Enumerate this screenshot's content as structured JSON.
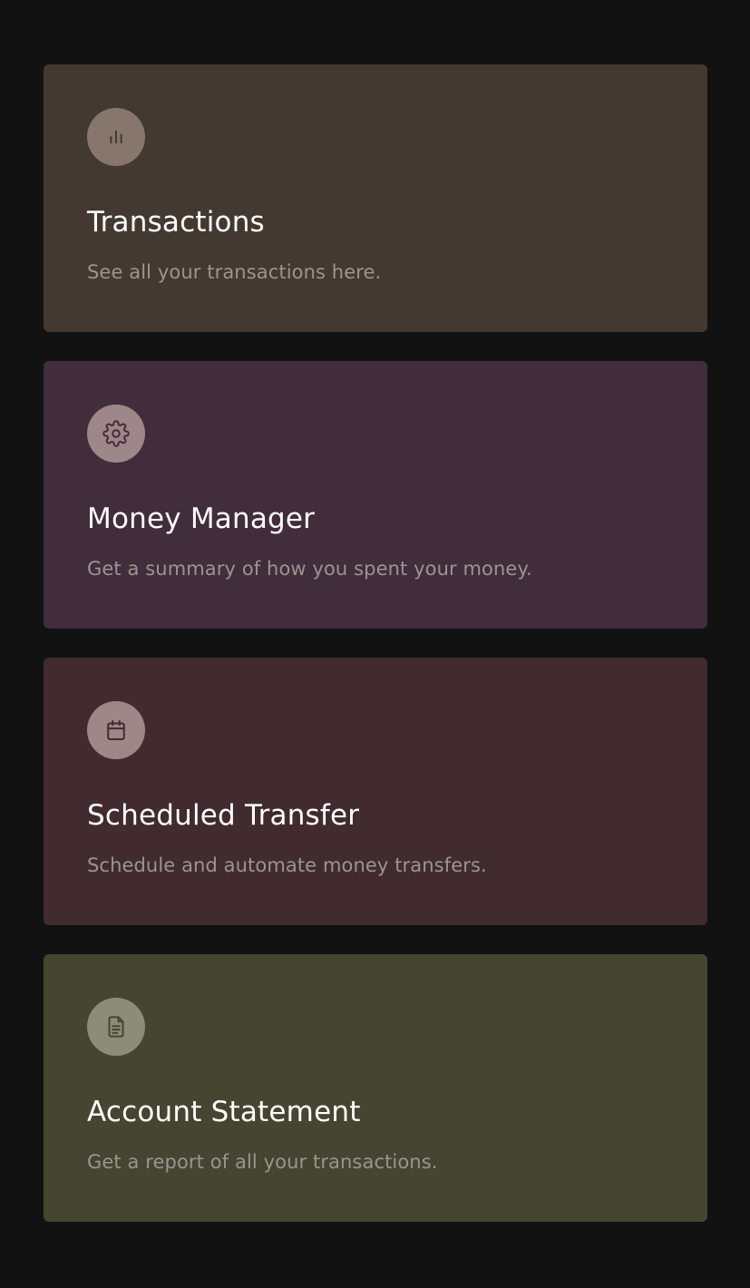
{
  "cards": [
    {
      "title": "Transactions",
      "description": "See all your transactions here.",
      "icon": "bar-chart-icon",
      "background": "#433931",
      "icon_bg": "#86766b",
      "icon_color": "#433931"
    },
    {
      "title": "Money Manager",
      "description": "Get a summary of how you spent your money.",
      "icon": "gear-icon",
      "background": "#412d3b",
      "icon_bg": "#9e8789",
      "icon_color": "#412d3b"
    },
    {
      "title": "Scheduled Transfer",
      "description": "Schedule and automate money transfers.",
      "icon": "calendar-icon",
      "background": "#412b2e",
      "icon_bg": "#9f8789",
      "icon_color": "#412b2e"
    },
    {
      "title": "Account Statement",
      "description": "Get a report of all your transactions.",
      "icon": "document-icon",
      "background": "#454531",
      "icon_bg": "#8d8c7a",
      "icon_color": "#454531"
    }
  ]
}
